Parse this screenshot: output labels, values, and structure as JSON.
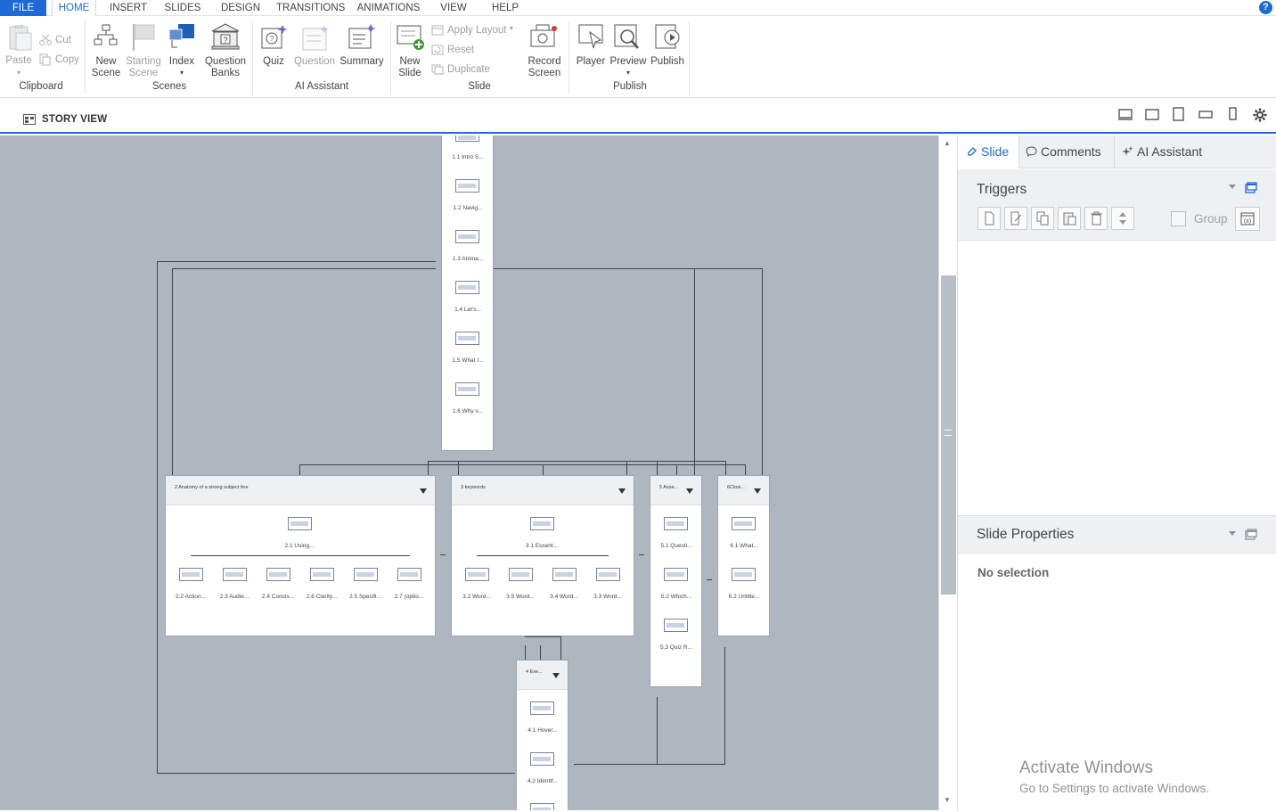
{
  "menu": {
    "tabs": [
      "FILE",
      "HOME",
      "INSERT",
      "SLIDES",
      "DESIGN",
      "TRANSITIONS",
      "ANIMATIONS",
      "VIEW",
      "HELP"
    ],
    "active": "HOME",
    "help": "?"
  },
  "ribbon": {
    "clipboard": {
      "paste": "Paste",
      "cut": "Cut",
      "copy": "Copy",
      "group": "Clipboard"
    },
    "scenes": {
      "new_scene": [
        "New",
        "Scene"
      ],
      "starting_scene": [
        "Starting",
        "Scene"
      ],
      "index": "Index",
      "question_banks": [
        "Question",
        "Banks"
      ],
      "group": "Scenes"
    },
    "ai": {
      "quiz": "Quiz",
      "question": "Question",
      "summary": "Summary",
      "group": "AI Assistant"
    },
    "slide": {
      "new_slide": [
        "New",
        "Slide"
      ],
      "apply_layout": "Apply Layout",
      "reset": "Reset",
      "duplicate": "Duplicate",
      "record_screen": [
        "Record",
        "Screen"
      ],
      "group": "Slide"
    },
    "publish": {
      "player": "Player",
      "preview": "Preview",
      "publish": "Publish",
      "group": "Publish"
    }
  },
  "storybar": {
    "label": "STORY VIEW"
  },
  "panel": {
    "tabs": {
      "slide": "Slide",
      "comments": "Comments",
      "ai": "AI Assistant"
    },
    "triggers_title": "Triggers",
    "group_label": "Group",
    "slide_properties_title": "Slide Properties",
    "no_selection": "No selection"
  },
  "scenes": {
    "scene1": {
      "slides": [
        "1.1 Intro S...",
        "1.2 Navig...",
        "1.3 Anima...",
        "1.4  Let's...",
        "1.5 What I...",
        "1.6 Why s..."
      ]
    },
    "scene2": {
      "title": "2 Anatomy of a strong subject line",
      "top": "2.1 Using...",
      "slides": [
        "2.2 Action...",
        "2.3 Audie...",
        "2.4 Concis...",
        "2.6 Clarity...",
        "2.5 Specifi...",
        "2.7 (optio..."
      ]
    },
    "scene3": {
      "title": "3 keywords",
      "top": "3.1 Essent...",
      "slides": [
        "3.2 Word...",
        "3.5 Word...",
        "3.4 Word...",
        "3.3 Word..."
      ]
    },
    "scene5": {
      "title": "5 Asse...",
      "slides": [
        "5.1 Questi...",
        "5.2 Which...",
        "5.3 Quiz R..."
      ]
    },
    "scene6": {
      "title": "6Closi...",
      "slides": [
        "6.1 What...",
        "6.2 Untitle..."
      ]
    },
    "scene4": {
      "title": "4 Exe...",
      "slides": [
        "4.1 Hover...",
        "4.2 Identif..."
      ]
    }
  },
  "watermark": {
    "title": "Activate Windows",
    "subtitle": "Go to Settings to activate Windows."
  }
}
